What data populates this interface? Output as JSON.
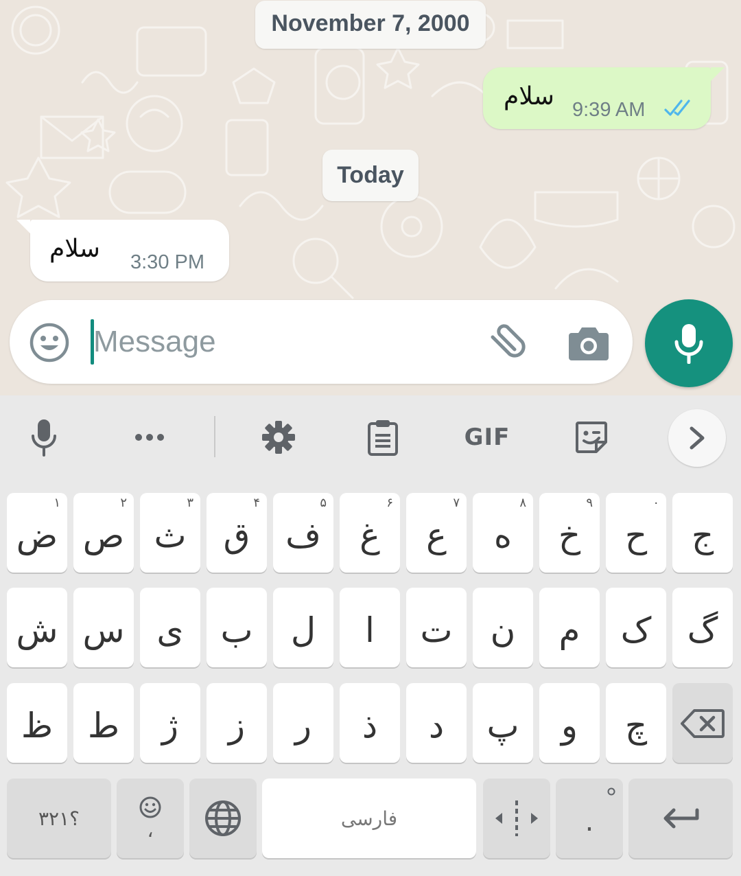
{
  "chat": {
    "date_chips": [
      "November 7, 2000",
      "Today"
    ],
    "outgoing": {
      "text": "سلام",
      "time": "9:39 AM",
      "status": "read"
    },
    "incoming": {
      "text": "سلام",
      "time": "3:30 PM"
    }
  },
  "composer": {
    "placeholder": "Message"
  },
  "keyboard": {
    "toolbar": {
      "gif_label": "GIF"
    },
    "rows": [
      [
        {
          "ch": "ض",
          "hint": "۱"
        },
        {
          "ch": "ص",
          "hint": "۲"
        },
        {
          "ch": "ث",
          "hint": "۳"
        },
        {
          "ch": "ق",
          "hint": "۴"
        },
        {
          "ch": "ف",
          "hint": "۵"
        },
        {
          "ch": "غ",
          "hint": "۶"
        },
        {
          "ch": "ع",
          "hint": "۷"
        },
        {
          "ch": "ه",
          "hint": "۸"
        },
        {
          "ch": "خ",
          "hint": "۹"
        },
        {
          "ch": "ح",
          "hint": "۰"
        },
        {
          "ch": "ج",
          "hint": ""
        }
      ],
      [
        {
          "ch": "ش"
        },
        {
          "ch": "س"
        },
        {
          "ch": "ی"
        },
        {
          "ch": "ب"
        },
        {
          "ch": "ل"
        },
        {
          "ch": "ا"
        },
        {
          "ch": "ت"
        },
        {
          "ch": "ن"
        },
        {
          "ch": "م"
        },
        {
          "ch": "ک"
        },
        {
          "ch": "گ"
        }
      ],
      [
        {
          "ch": "ظ"
        },
        {
          "ch": "ط"
        },
        {
          "ch": "ژ"
        },
        {
          "ch": "ز"
        },
        {
          "ch": "ر"
        },
        {
          "ch": "ذ"
        },
        {
          "ch": "د"
        },
        {
          "ch": "پ"
        },
        {
          "ch": "و"
        },
        {
          "ch": "چ"
        }
      ]
    ],
    "bottom": {
      "symbols_label": "؟۳۲۱",
      "comma_label": "،",
      "space_label": "فارسی",
      "period_label": "."
    }
  }
}
